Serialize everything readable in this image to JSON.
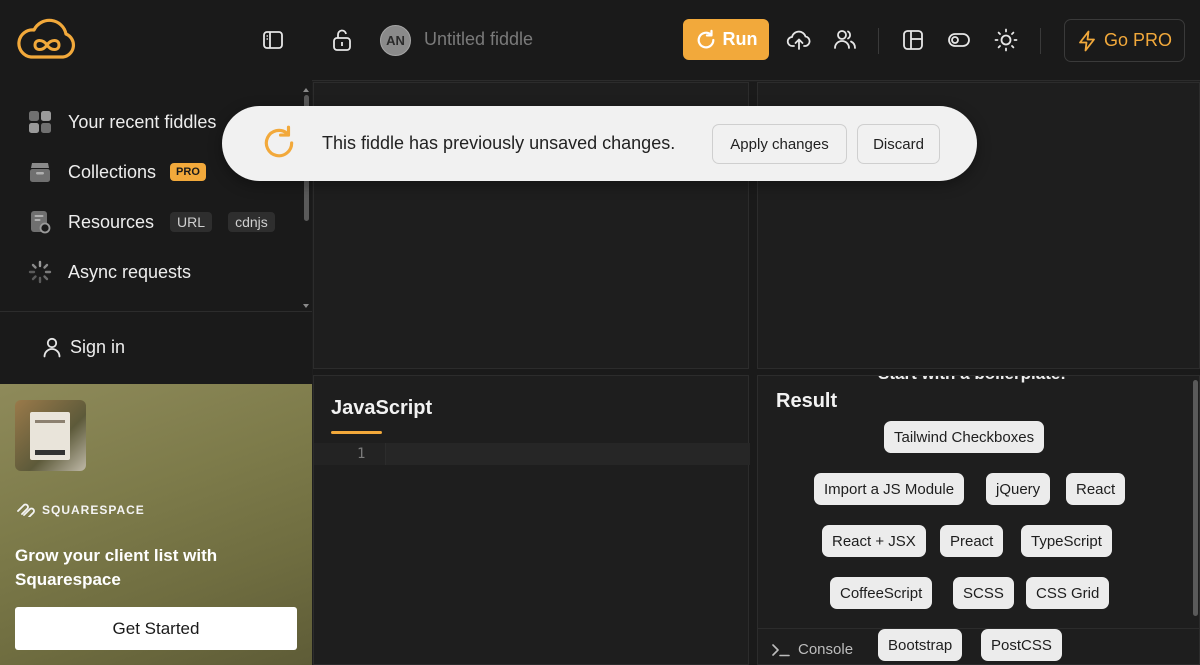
{
  "header": {
    "avatar_initials": "AN",
    "fiddle_title": "Untitled fiddle",
    "run_label": "Run",
    "go_pro_label": "Go PRO",
    "accent_color": "#f2a93b"
  },
  "sidebar": {
    "items": [
      {
        "label": "Your recent fiddles",
        "icon": "grid-icon"
      },
      {
        "label": "Collections",
        "icon": "archive-icon",
        "badge": "PRO"
      },
      {
        "label": "Resources",
        "icon": "file-icon",
        "chips": [
          "URL",
          "cdnjs"
        ]
      },
      {
        "label": "Async requests",
        "icon": "spinner-icon"
      }
    ],
    "sign_in_label": "Sign in"
  },
  "ad": {
    "brand": "SQUARESPACE",
    "text": "Grow your client list with Squarespace",
    "cta": "Get Started"
  },
  "toast": {
    "message": "This fiddle has previously unsaved changes.",
    "apply_label": "Apply changes",
    "discard_label": "Discard"
  },
  "editor": {
    "js_title": "JavaScript",
    "line_numbers": [
      "1"
    ]
  },
  "result": {
    "title": "Result",
    "boilerplate_heading": "Start with a boilerplate:",
    "boilerplates": [
      "Tailwind Checkboxes",
      "Import a JS Module",
      "jQuery",
      "React",
      "React + JSX",
      "Preact",
      "TypeScript",
      "CoffeeScript",
      "SCSS",
      "CSS Grid",
      "Bootstrap",
      "PostCSS"
    ],
    "console_label": "Console"
  }
}
